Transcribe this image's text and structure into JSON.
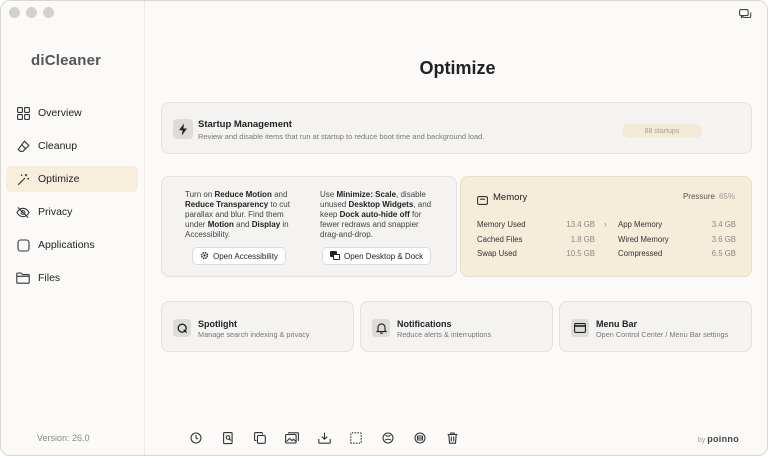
{
  "app": {
    "title": "diCleaner",
    "version": "Version: 26.0",
    "by": "by",
    "brand": "poinno"
  },
  "sidebar": {
    "items": [
      {
        "label": "Overview",
        "icon": "grid-icon",
        "active": false
      },
      {
        "label": "Cleanup",
        "icon": "eraser-icon",
        "active": false
      },
      {
        "label": "Optimize",
        "icon": "magic-wand-icon",
        "active": true
      },
      {
        "label": "Privacy",
        "icon": "eye-slash-icon",
        "active": false
      },
      {
        "label": "Applications",
        "icon": "app-square-icon",
        "active": false
      },
      {
        "label": "Files",
        "icon": "folder-icon",
        "active": false
      }
    ]
  },
  "main": {
    "title": "Optimize",
    "startup": {
      "title": "Startup Management",
      "description": "Review and disable items that run at startup to reduce boot time and background load.",
      "badge": "88 startups"
    },
    "tips": {
      "a": {
        "p1": "Turn on ",
        "b1": "Reduce Motion",
        "p2": " and ",
        "b2": "Reduce Transparency",
        "p3": " to cut parallax and blur. Find them under ",
        "b3": "Motion",
        "p4": " and ",
        "b4": "Display",
        "p5": " in Accessibility.",
        "button": "Open Accessibility"
      },
      "b": {
        "p1": "Use ",
        "b1": "Minimize: Scale",
        "p2": ", disable unused ",
        "b2": "Desktop Widgets",
        "p3": ", and keep ",
        "b3": "Dock auto-hide off",
        "p4": " for fewer redraws and snappier drag-and-drop.",
        "button": "Open Desktop & Dock"
      }
    },
    "memory": {
      "title": "Memory",
      "pressure_label": "Pressure",
      "pressure_value": "65%",
      "left": [
        {
          "label": "Memory Used",
          "value": "13.4 GB"
        },
        {
          "label": "Cached Files",
          "value": "1.8 GB"
        },
        {
          "label": "Swap Used",
          "value": "10.5 GB"
        }
      ],
      "right": [
        {
          "label": "App Memory",
          "value": "3.4 GB"
        },
        {
          "label": "Wired Memory",
          "value": "3.6 GB"
        },
        {
          "label": "Compressed",
          "value": "6.5 GB"
        }
      ]
    },
    "cards": [
      {
        "title": "Spotlight",
        "description": "Manage search indexing & privacy",
        "icon": "magnifier-icon"
      },
      {
        "title": "Notifications",
        "description": "Reduce alerts & interruptions",
        "icon": "bell-icon"
      },
      {
        "title": "Menu Bar",
        "description": "Open Control Center / Menu Bar settings",
        "icon": "window-icon"
      }
    ]
  },
  "toolbar": {
    "icons": [
      "clock-icon",
      "document-search-icon",
      "copy-icon",
      "photos-icon",
      "download-tray-icon",
      "dashed-square-icon",
      "globe-icon",
      "disk-icon",
      "trash-icon"
    ]
  },
  "colors": {
    "accent": "#f7eedb",
    "memory_bg": "#f5edd9",
    "window_bg": "#fbfaf8"
  }
}
